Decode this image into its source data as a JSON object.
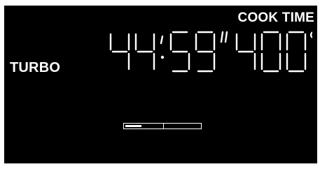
{
  "header": {
    "label": "COOK TIME"
  },
  "mode": {
    "label": "TURBO"
  },
  "timer": {
    "minutes": "44",
    "seconds": "59",
    "seconds_mark": "”"
  },
  "temperature": {
    "value": "400",
    "unit_mark": "°"
  },
  "progress": {
    "fraction": 0.22
  }
}
